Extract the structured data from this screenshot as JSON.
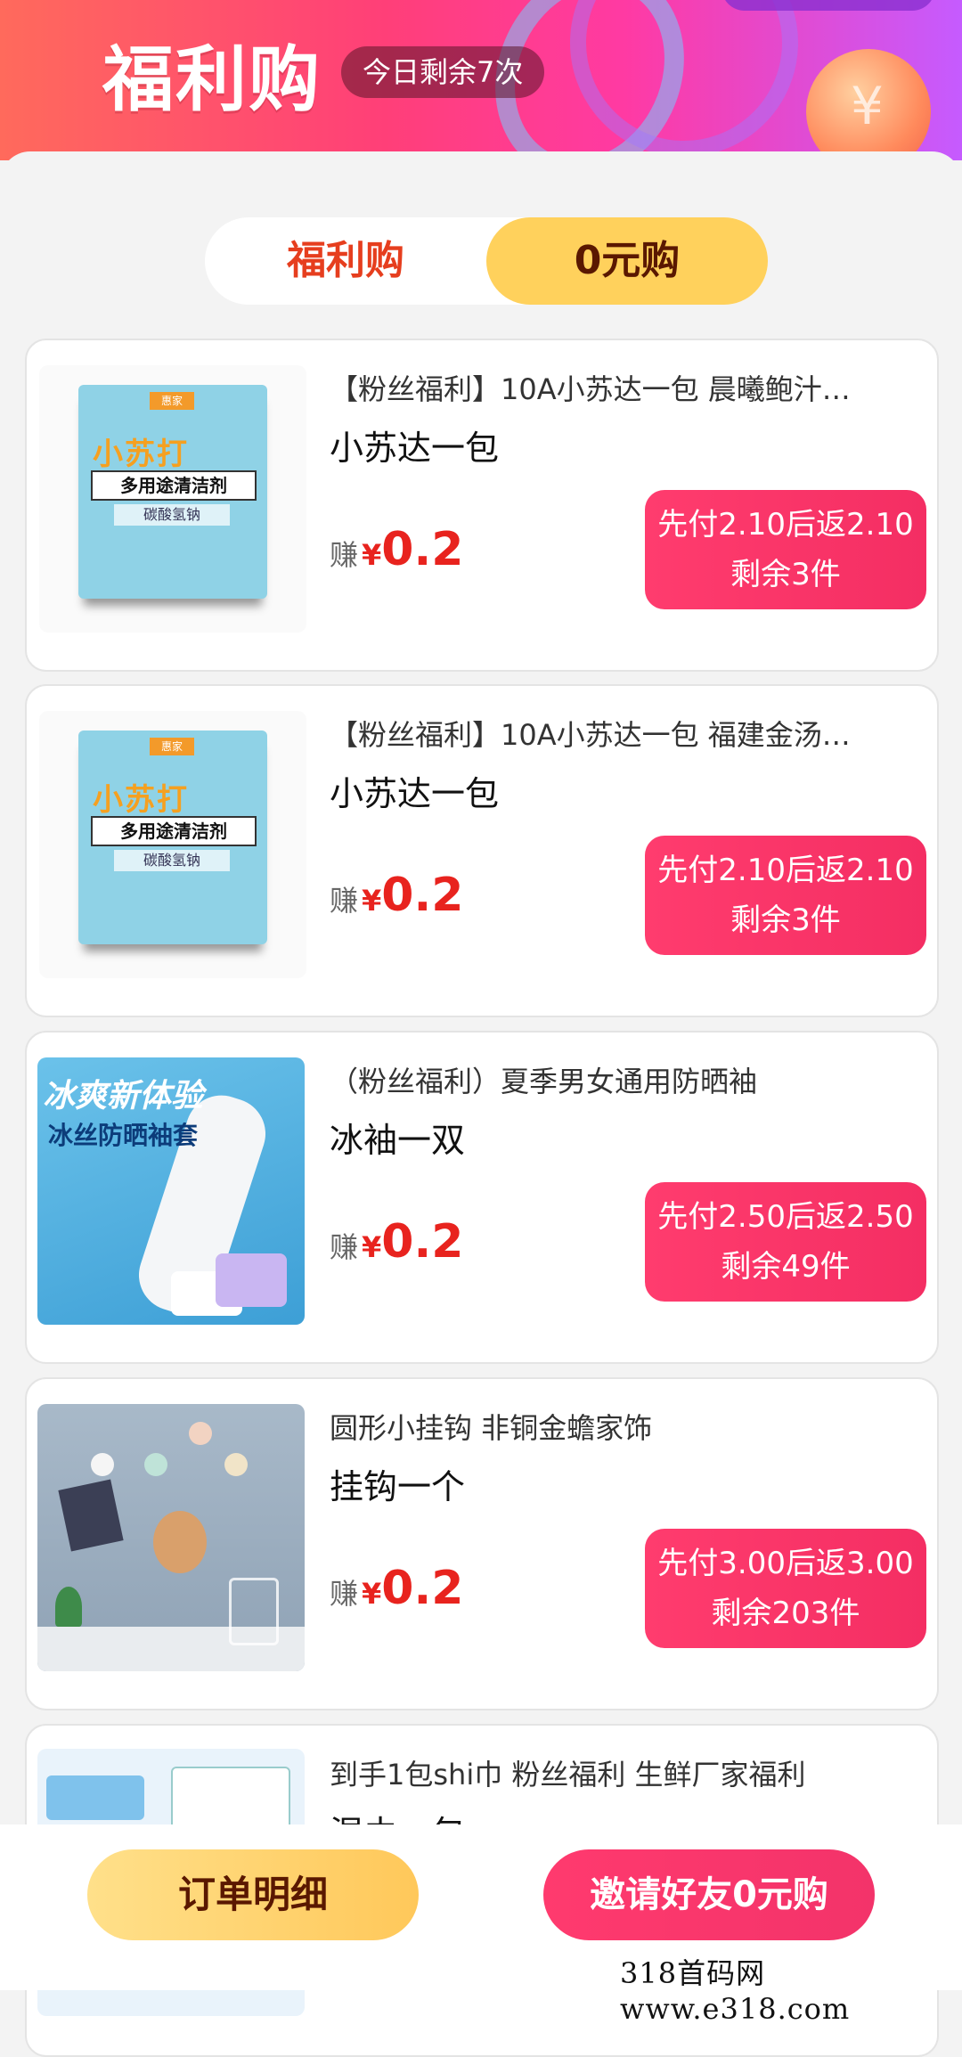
{
  "header": {
    "title": "福利购",
    "remaining_badge": "今日剩余7次"
  },
  "tabs": [
    {
      "label": "福利购",
      "active": false
    },
    {
      "label": "0元购",
      "active": true
    }
  ],
  "products": [
    {
      "title": "【粉丝福利】10A小苏达一包 晨曦鲍汁…",
      "name": "小苏达一包",
      "earn_label": "赚",
      "currency": "¥",
      "earn": "0.2",
      "pay_line": "先付2.10后返2.10",
      "stock_line": "剩余3件",
      "image": "baking-soda-packet"
    },
    {
      "title": "【粉丝福利】10A小苏达一包 福建金汤…",
      "name": "小苏达一包",
      "earn_label": "赚",
      "currency": "¥",
      "earn": "0.2",
      "pay_line": "先付2.10后返2.10",
      "stock_line": "剩余3件",
      "image": "baking-soda-packet"
    },
    {
      "title": "（粉丝福利）夏季男女通用防晒袖",
      "name": "冰袖一双",
      "earn_label": "赚",
      "currency": "¥",
      "earn": "0.2",
      "pay_line": "先付2.50后返2.50",
      "stock_line": "剩余49件",
      "image": "ice-sleeve"
    },
    {
      "title": "圆形小挂钩 非铜金蟾家饰",
      "name": "挂钩一个",
      "earn_label": "赚",
      "currency": "¥",
      "earn": "0.2",
      "pay_line": "先付3.00后返3.00",
      "stock_line": "剩余203件",
      "image": "wall-hooks"
    },
    {
      "title": "到手1包shi巾 粉丝福利 生鲜厂家福利",
      "name": "湿巾一包",
      "image": "wet-wipes"
    }
  ],
  "soda_packet": {
    "brand": "惠家",
    "title": "小苏打",
    "band": "多用途清洁剂",
    "sub": "碳酸氢钠"
  },
  "sleeve_image": {
    "line1": "冰爽新体验",
    "line2": "冰丝防晒袖套"
  },
  "bottom": {
    "orders_label": "订单明细",
    "invite_label": "邀请好友0元购"
  },
  "watermark": "318首码网  www.e318.com",
  "colors": {
    "accent_red": "#e8231e",
    "button_pink": "#f42e63",
    "tab_yellow": "#ffd15c"
  }
}
